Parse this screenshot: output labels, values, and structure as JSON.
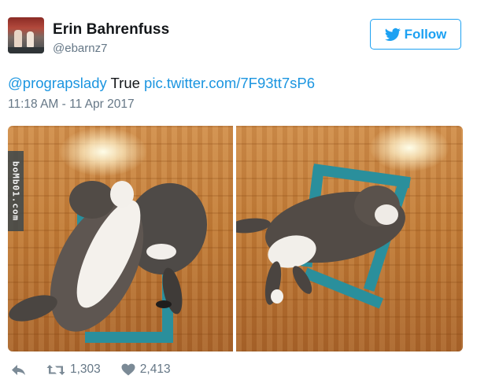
{
  "author": {
    "name": "Erin Bahrenfuss",
    "handle": "@ebarnz7"
  },
  "follow_button": {
    "label": "Follow",
    "icon": "twitter-bird-icon"
  },
  "tweet": {
    "mention": "@prograpslady",
    "text": "True",
    "link": "pic.twitter.com/7F93tt7sP6",
    "timestamp": "11:18 AM - 11 Apr 2017"
  },
  "media": {
    "watermark": "boMb01.com",
    "photos": [
      {
        "description_icon": "cat-in-tape-square-photo"
      },
      {
        "description_icon": "cat-in-tape-square-photo"
      }
    ]
  },
  "actions": {
    "reply_icon": "reply-icon",
    "retweet_icon": "retweet-icon",
    "retweet_count": "1,303",
    "like_icon": "heart-icon",
    "like_count": "2,413"
  },
  "colors": {
    "accent": "#1da1f2",
    "link": "#1b95e0",
    "muted": "#657786",
    "tape": "#2a8f9c"
  }
}
